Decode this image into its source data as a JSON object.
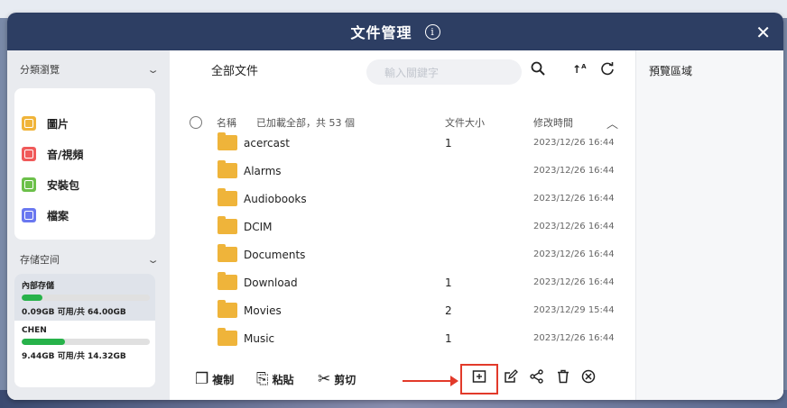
{
  "window": {
    "title": "文件管理",
    "info_icon": "info-icon",
    "close_glyph": "✕"
  },
  "sidebar": {
    "browse_label": "分類瀏覽",
    "categories": [
      {
        "label": "圖片",
        "icon": "image-icon",
        "color": "#f0b43a"
      },
      {
        "label": "音/視頻",
        "icon": "video-icon",
        "color": "#f05a5a"
      },
      {
        "label": "安裝包",
        "icon": "package-icon",
        "color": "#6cc04a"
      },
      {
        "label": "檔案",
        "icon": "document-icon",
        "color": "#6a78f0"
      }
    ],
    "storage_label": "存储空间",
    "storages": [
      {
        "name": "內部存儲",
        "usage_text": "0.09GB 可用/共 64.00GB",
        "used_fraction": 0.16
      },
      {
        "name": "CHEN",
        "usage_text": "9.44GB 可用/共 14.32GB",
        "used_fraction": 0.34
      }
    ]
  },
  "main": {
    "breadcrumb": "全部文件",
    "search_placeholder": "輸入關鍵字",
    "columns": {
      "name": "名稱",
      "loaded": "已加載全部，共 53 個",
      "size": "文件大小",
      "modified": "修改時間"
    },
    "files": [
      {
        "name": "acercast",
        "size": "1",
        "modified": "2023/12/26 16:44"
      },
      {
        "name": "Alarms",
        "size": "",
        "modified": "2023/12/26 16:44"
      },
      {
        "name": "Audiobooks",
        "size": "",
        "modified": "2023/12/26 16:44"
      },
      {
        "name": "DCIM",
        "size": "",
        "modified": "2023/12/26 16:44"
      },
      {
        "name": "Documents",
        "size": "",
        "modified": "2023/12/26 16:44"
      },
      {
        "name": "Download",
        "size": "1",
        "modified": "2023/12/26 16:44"
      },
      {
        "name": "Movies",
        "size": "2",
        "modified": "2023/12/29 15:44"
      },
      {
        "name": "Music",
        "size": "1",
        "modified": "2023/12/26 16:44"
      }
    ]
  },
  "toolbar": {
    "copy": "複制",
    "paste": "粘貼",
    "cut": "剪切"
  },
  "preview": {
    "label": "預覽區域"
  },
  "colors": {
    "titlebar": "#2d3e63",
    "highlight": "#e23a2a",
    "folder": "#efb43a",
    "storage_fill": "#27b24a"
  }
}
